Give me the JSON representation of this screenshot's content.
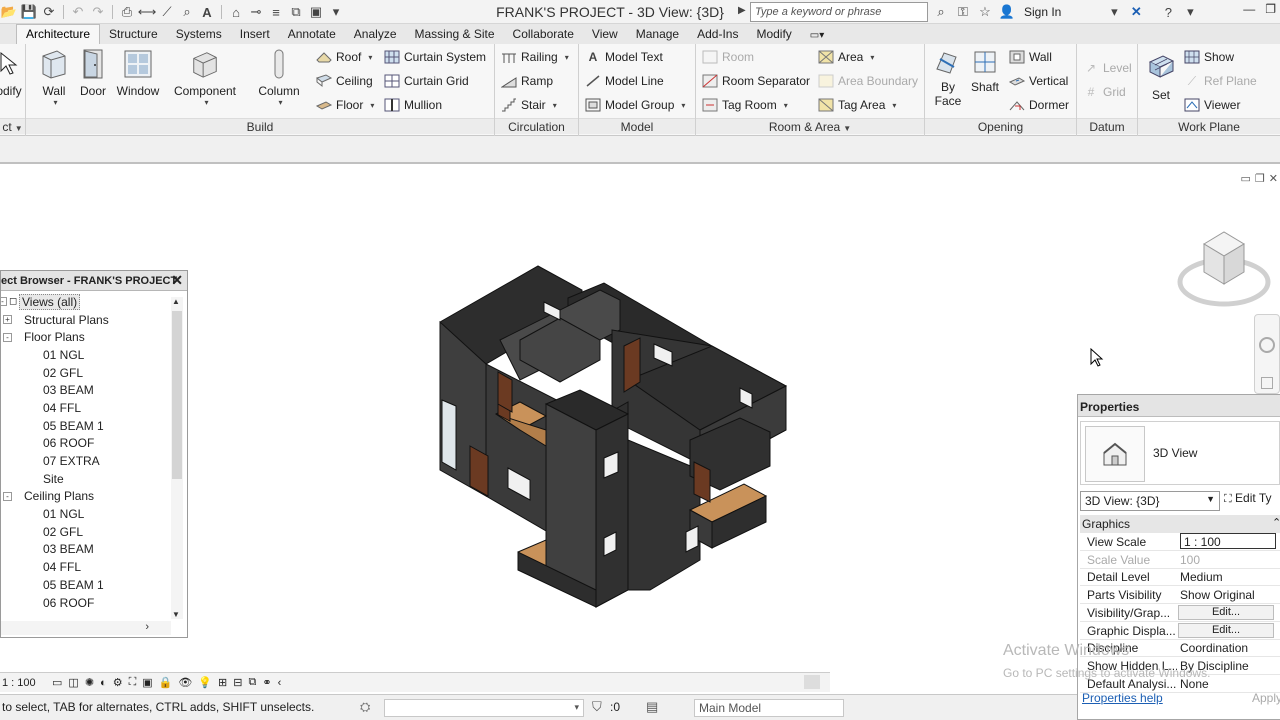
{
  "app": {
    "title": "FRANK'S PROJECT - 3D View: {3D}",
    "search_placeholder": "Type a keyword or phrase",
    "sign_in": "Sign In"
  },
  "tabs": [
    "Architecture",
    "Structure",
    "Systems",
    "Insert",
    "Annotate",
    "Analyze",
    "Massing & Site",
    "Collaborate",
    "View",
    "Manage",
    "Add-Ins",
    "Modify"
  ],
  "ribbon": {
    "select": {
      "modify": "odify",
      "title": "ct"
    },
    "build": {
      "title": "Build",
      "wall": "Wall",
      "door": "Door",
      "window": "Window",
      "component": "Component",
      "column": "Column",
      "roof": "Roof",
      "ceiling": "Ceiling",
      "floor": "Floor",
      "curtain_system": "Curtain System",
      "curtain_grid": "Curtain Grid",
      "mullion": "Mullion"
    },
    "circulation": {
      "title": "Circulation",
      "railing": "Railing",
      "ramp": "Ramp",
      "stair": "Stair"
    },
    "model": {
      "title": "Model",
      "model_text": "Model Text",
      "model_line": "Model Line",
      "model_group": "Model Group"
    },
    "room_area": {
      "title": "Room & Area",
      "room": "Room",
      "room_separator": "Room Separator",
      "tag_room": "Tag Room",
      "area": "Area",
      "area_boundary": "Area Boundary",
      "tag_area": "Tag Area"
    },
    "opening": {
      "title": "Opening",
      "by_face": "By Face",
      "by_face_2": "Face",
      "shaft": "Shaft",
      "wall": "Wall",
      "vertical": "Vertical",
      "dormer": "Dormer"
    },
    "datum": {
      "title": "Datum",
      "level": "Level",
      "grid": "Grid"
    },
    "work_plane": {
      "title": "Work Plane",
      "set": "Set",
      "show": "Show",
      "ref_plane": "Ref Plane",
      "viewer": "Viewer"
    }
  },
  "project_browser": {
    "title": "ect Browser - FRANK'S PROJECT",
    "items": [
      {
        "label": "Views (all)",
        "level": 0,
        "toggle": "-",
        "selected": true
      },
      {
        "label": "Structural Plans",
        "level": 1,
        "toggle": "+"
      },
      {
        "label": "Floor Plans",
        "level": 1,
        "toggle": "-"
      },
      {
        "label": "01 NGL",
        "level": 2
      },
      {
        "label": "02 GFL",
        "level": 2
      },
      {
        "label": "03 BEAM",
        "level": 2
      },
      {
        "label": "04 FFL",
        "level": 2
      },
      {
        "label": "05 BEAM 1",
        "level": 2
      },
      {
        "label": "06 ROOF",
        "level": 2
      },
      {
        "label": "07 EXTRA",
        "level": 2
      },
      {
        "label": "Site",
        "level": 2
      },
      {
        "label": "Ceiling Plans",
        "level": 1,
        "toggle": "-"
      },
      {
        "label": "01 NGL",
        "level": 2
      },
      {
        "label": "02 GFL",
        "level": 2
      },
      {
        "label": "03 BEAM",
        "level": 2
      },
      {
        "label": "04 FFL",
        "level": 2
      },
      {
        "label": "05 BEAM 1",
        "level": 2
      },
      {
        "label": "06 ROOF",
        "level": 2
      }
    ]
  },
  "properties": {
    "title": "Properties",
    "type_name": "3D View",
    "type_selector": "3D View: {3D}",
    "edit_type": "Edit Ty",
    "group": "Graphics",
    "rows": [
      {
        "name": "View Scale",
        "value": "1 : 100"
      },
      {
        "name": "Scale Value",
        "value": "100",
        "disabled": true
      },
      {
        "name": "Detail Level",
        "value": "Medium"
      },
      {
        "name": "Parts Visibility",
        "value": "Show Original"
      },
      {
        "name": "Visibility/Grap...",
        "value": "Edit...",
        "button": true
      },
      {
        "name": "Graphic Displa...",
        "value": "Edit...",
        "button": true
      },
      {
        "name": "Discipline",
        "value": "Coordination"
      },
      {
        "name": "Show Hidden L...",
        "value": "By Discipline"
      },
      {
        "name": "Default Analysi...",
        "value": "None"
      }
    ],
    "help": "Properties help",
    "apply": "Apply"
  },
  "watermark": {
    "line1": "Activate Windows",
    "line2": "Go to PC settings to activate Windows."
  },
  "viewbar": {
    "scale": "1 : 100"
  },
  "status": {
    "text": "to select, TAB for alternates, CTRL adds, SHIFT unselects.",
    "count": ":0",
    "workset": "Main Model"
  },
  "colors": {
    "accent": "#1c5fb4",
    "wall": "#3d3d3d",
    "floor": "#c9925a"
  }
}
